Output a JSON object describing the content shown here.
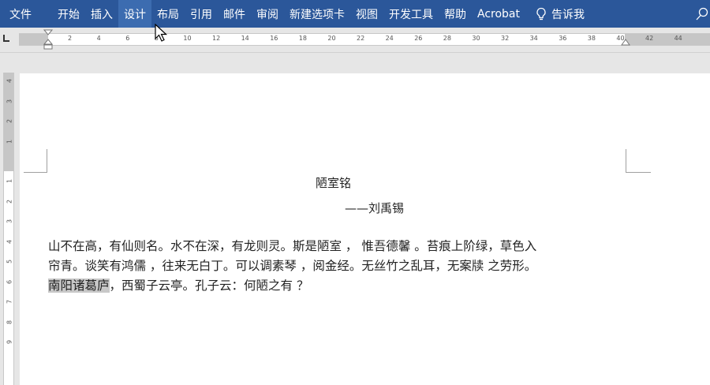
{
  "ribbon": {
    "file": "文件",
    "tabs": [
      "开始",
      "插入",
      "设计",
      "布局",
      "引用",
      "邮件",
      "审阅",
      "新建选项卡",
      "视图",
      "开发工具",
      "帮助",
      "Acrobat"
    ],
    "tell_me": "告诉我",
    "accent_color": "#2b579a"
  },
  "ruler": {
    "numbers": [
      "2",
      "4",
      "6",
      "8",
      "10",
      "12",
      "14",
      "16",
      "18",
      "20",
      "22",
      "24",
      "26",
      "28",
      "30",
      "32",
      "34",
      "36",
      "38",
      "40",
      "42",
      "44"
    ],
    "vertical_numbers": [
      "4",
      "3",
      "2",
      "1",
      "1",
      "2",
      "3",
      "4",
      "5",
      "6",
      "7",
      "8",
      "9"
    ]
  },
  "document": {
    "title": "陋室铭",
    "author": "——刘禹锡",
    "lines": [
      "山不在高，有仙则名。水不在深，有龙则灵。斯是陋室 ， 惟吾德馨 。苔痕上阶绿，草色入",
      "帘青。谈笑有鸿儒 ，往来无白丁。可以调素琴 ，阅金经。无丝竹之乱耳，无案牍 之劳形。"
    ],
    "last_line_selected": "南阳诸葛庐",
    "last_line_rest": "，西蜀子云亭。孔子云：何陋之有 ？"
  }
}
